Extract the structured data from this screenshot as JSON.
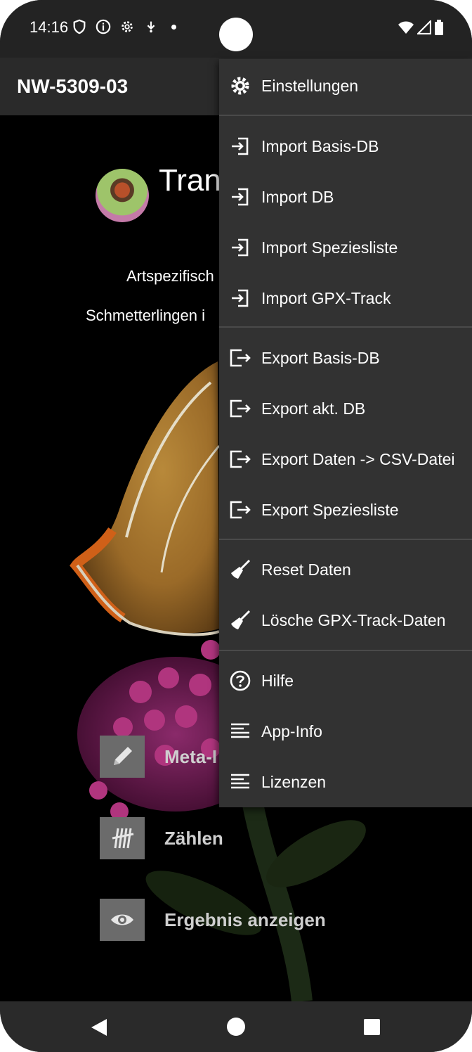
{
  "status": {
    "time": "14:16"
  },
  "appbar": {
    "title": "NW-5309-03"
  },
  "main": {
    "app_name": "Tran",
    "subtitle_line1": "Artspezifisch",
    "subtitle_line2": "Schmetterlingen i",
    "buttons": [
      {
        "label": "Meta-I",
        "icon": "pencil-icon"
      },
      {
        "label": "Zählen",
        "icon": "tally-icon"
      },
      {
        "label": "Ergebnis anzeigen",
        "icon": "eye-icon"
      }
    ]
  },
  "menu": {
    "items": [
      {
        "label": "Einstellungen",
        "icon": "gear-icon"
      },
      {
        "label": "Import Basis-DB",
        "icon": "import-icon"
      },
      {
        "label": "Import DB",
        "icon": "import-icon"
      },
      {
        "label": "Import Speziesliste",
        "icon": "import-icon"
      },
      {
        "label": "Import GPX-Track",
        "icon": "import-icon"
      },
      {
        "label": "Export Basis-DB",
        "icon": "export-icon"
      },
      {
        "label": "Export akt. DB",
        "icon": "export-icon"
      },
      {
        "label": "Export Daten -> CSV-Datei",
        "icon": "export-icon"
      },
      {
        "label": "Export Speziesliste",
        "icon": "export-icon"
      },
      {
        "label": "Reset Daten",
        "icon": "broom-icon"
      },
      {
        "label": "Lösche GPX-Track-Daten",
        "icon": "broom-icon"
      },
      {
        "label": "Hilfe",
        "icon": "help-icon"
      },
      {
        "label": "App-Info",
        "icon": "text-lines-icon"
      },
      {
        "label": "Lizenzen",
        "icon": "text-lines-icon"
      }
    ]
  },
  "colors": {
    "appbar": "#2a2a2a",
    "menu_background": "#323232",
    "button_background": "#6b6b6b"
  }
}
